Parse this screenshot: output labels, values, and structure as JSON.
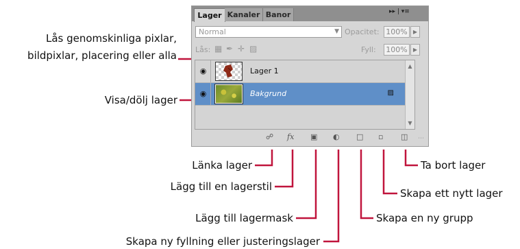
{
  "panel": {
    "tabs": [
      "Lager",
      "Kanaler",
      "Banor"
    ],
    "tab_controls": "▸▸  |  ▾≡",
    "blend_mode": "Normal",
    "opacity_label": "Opacitet:",
    "opacity_value": "100%",
    "lock_label": "Lås:",
    "fill_label": "Fyll:",
    "fill_value": "100%",
    "layers": [
      {
        "name": "Lager 1",
        "visible": true,
        "selected": false
      },
      {
        "name": "Bakgrund",
        "visible": true,
        "selected": true,
        "locked": true
      }
    ]
  },
  "annotations": {
    "lock_line1": "Lås genomskinliga pixlar,",
    "lock_line2": "bildpixlar, placering eller alla",
    "visibility": "Visa/dölj lager",
    "link": "Länka lager",
    "style": "Lägg till en lagerstil",
    "mask": "Lägg till lagermask",
    "fill_adjust": "Skapa ny fyllning eller justeringslager",
    "group": "Skapa en ny grupp",
    "new_layer": "Skapa ett nytt lager",
    "delete": "Ta bort lager"
  },
  "colors": {
    "leader_line": "#c0143c",
    "selected_layer": "#5f8fc8"
  },
  "icons": {
    "lock_transparent": "checker-lock-icon",
    "lock_image": "brush-lock-icon",
    "lock_position": "move-lock-icon",
    "lock_all": "padlock-icon",
    "footer": [
      "link-icon",
      "fx-icon",
      "mask-icon",
      "adjustment-icon",
      "folder-icon",
      "new-layer-icon",
      "trash-icon"
    ]
  }
}
